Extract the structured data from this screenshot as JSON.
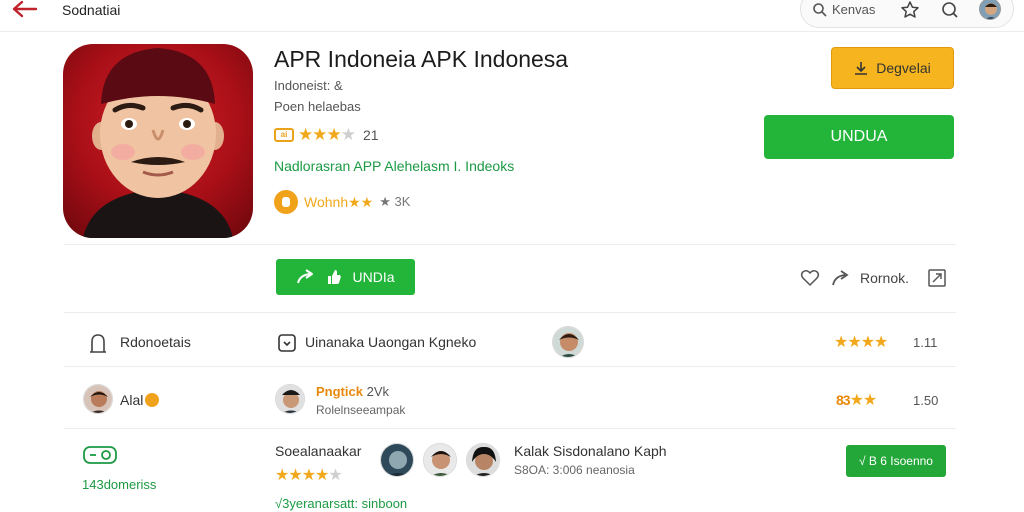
{
  "topbar": {
    "site_name": "Sodnatiai",
    "search_placeholder": "Kenvas"
  },
  "app": {
    "title": "APR Indoneia APK Indonesa",
    "developer": "Indoneist:",
    "developer_badge": "&",
    "subtitle": "Poen helaebas",
    "badge": "ai",
    "rating_value": "21",
    "rating_stars": 3.5,
    "tagline": "Nadlorasran APP Alehelasm I. Indeoks",
    "award_text": "Wohnh",
    "award_count": "3K"
  },
  "buttons": {
    "developer": "Degvelai",
    "download_primary": "UNDUA",
    "download_secondary": "UNDIa",
    "report": "Rornok."
  },
  "rows": [
    {
      "left_label": "Rdonoetais",
      "mid_label": "Uinanaka Uaongan Kgneko",
      "stars": 4,
      "num": "1.11"
    },
    {
      "left_label": "Alal",
      "mid_title": "Pngtick",
      "mid_title_extra": "2Vk",
      "mid_sub": "Rolelnseeampak",
      "stars_prefix": "83",
      "stars": 3,
      "num": "1.50"
    },
    {
      "left_label": "143domeriss",
      "mid_label": "Soealanaakar",
      "mid_right_title": "Kalak Sisdonalano Kaph",
      "mid_right_sub": "S8OA: 3:006 neanosia",
      "stars": 4,
      "footer": "√3yeranarsatt: sinboon",
      "button": "√ B 6 Isoenno"
    }
  ],
  "colors": {
    "green": "#23b43a",
    "orange": "#f6b51e",
    "star": "#f2a81b",
    "icon_red": "#b8141c"
  },
  "icons": [
    "back-arrow-icon",
    "search-icon",
    "star-icon",
    "bell-icon",
    "download-icon",
    "share-icon",
    "heart-icon",
    "flag-icon",
    "user-icon",
    "camera-icon"
  ]
}
